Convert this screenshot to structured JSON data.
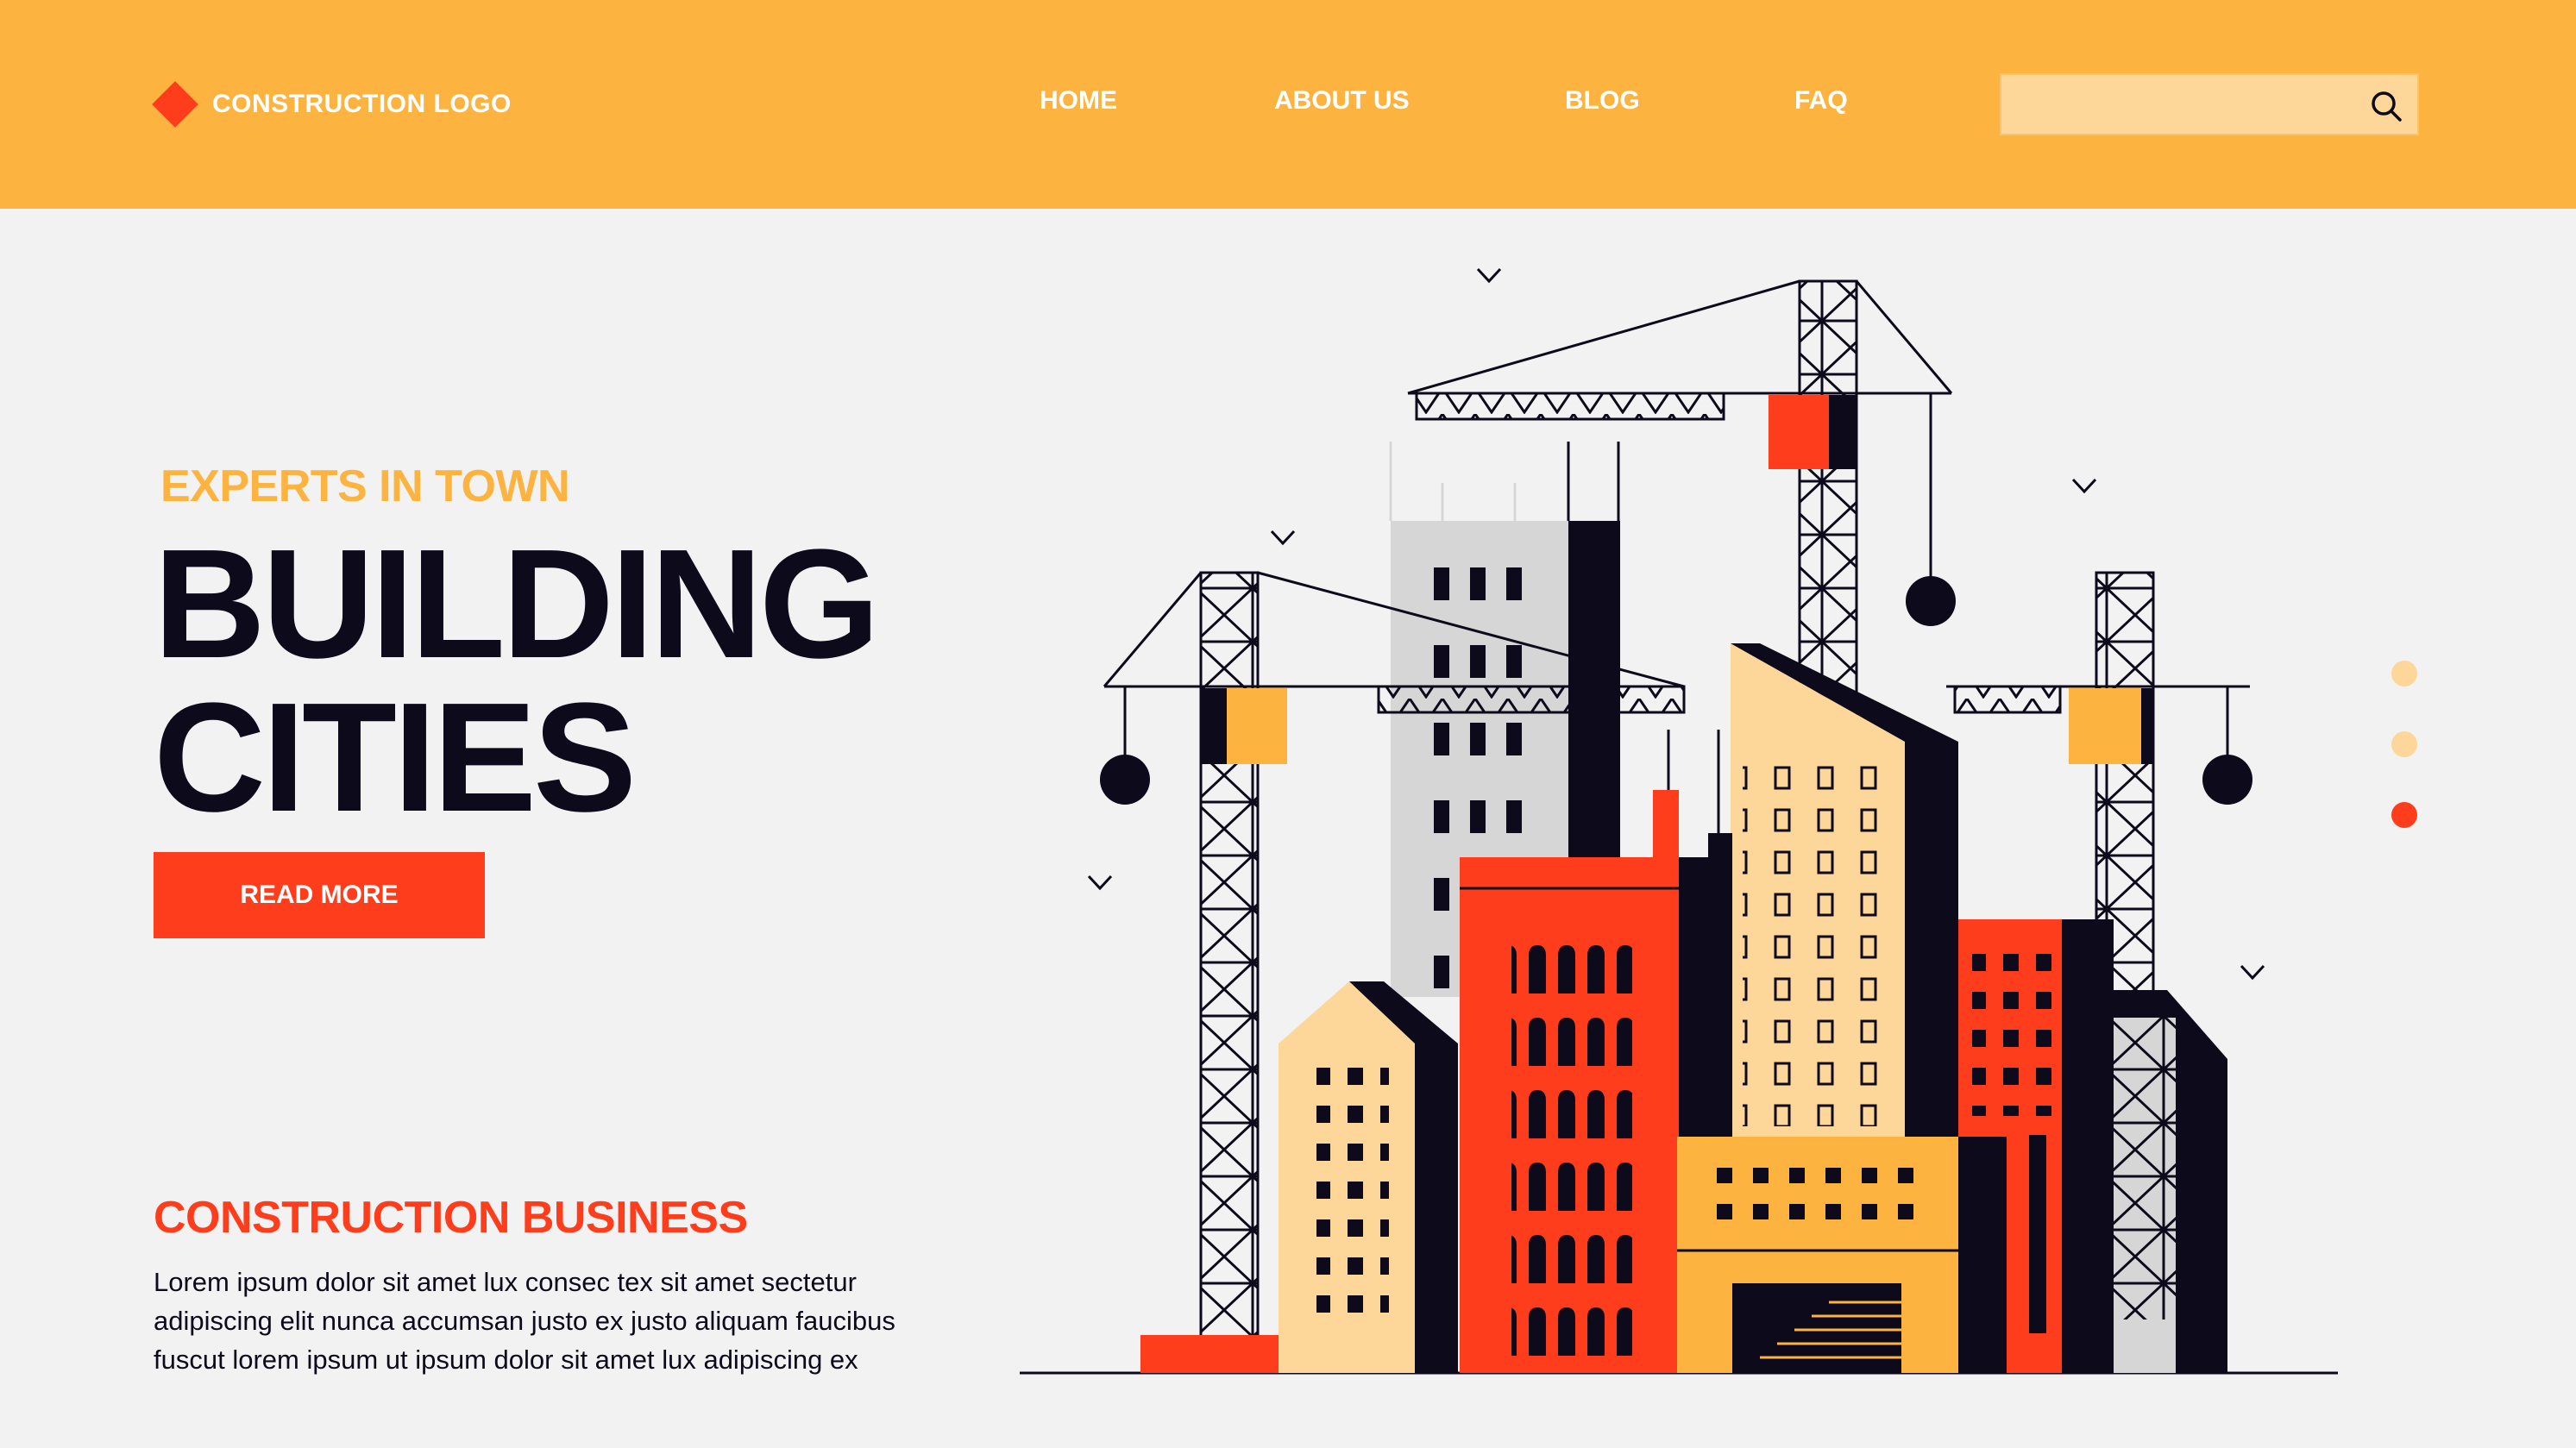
{
  "header": {
    "logo_text": "CONSTRUCTION LOGO",
    "nav": [
      "HOME",
      "ABOUT US",
      "BLOG",
      "FAQ"
    ],
    "search_placeholder": "",
    "search_icon": "search-icon"
  },
  "hero": {
    "tagline": "EXPERTS IN TOWN",
    "headline_line1": "BUILDING",
    "headline_line2": "CITIES",
    "cta_label": "READ MORE"
  },
  "about": {
    "title": "CONSTRUCTION BUSINESS",
    "lines": [
      "Lorem ipsum dolor sit amet lux consec tex sit amet sectetur",
      "adipiscing elit nunca accumsan justo ex justo aliquam faucibus",
      "fuscut lorem ipsum ut ipsum dolor sit amet lux adipiscing ex"
    ]
  },
  "carousel": {
    "slide_count": 3,
    "active_index": 2
  },
  "colors": {
    "header_bg": "#fcb33f",
    "accent_red": "#fe3d1c",
    "accent_yellow": "#fcb33f",
    "light_yellow": "#fdd69a",
    "dark": "#0d0a1c",
    "grey": "#d6d6d6",
    "background": "#f2f2f2"
  }
}
